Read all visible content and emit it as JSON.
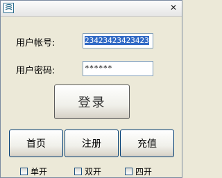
{
  "window": {
    "close_glyph": "✕"
  },
  "form": {
    "account_label": "用户帐号:",
    "account_value": "23423423423423",
    "password_label": "用户密码:",
    "password_value": "******"
  },
  "buttons": {
    "login": "登录",
    "home": "首页",
    "register": "注册",
    "recharge": "充值"
  },
  "options": [
    {
      "label": "单开"
    },
    {
      "label": "双开"
    },
    {
      "label": "四开"
    }
  ]
}
